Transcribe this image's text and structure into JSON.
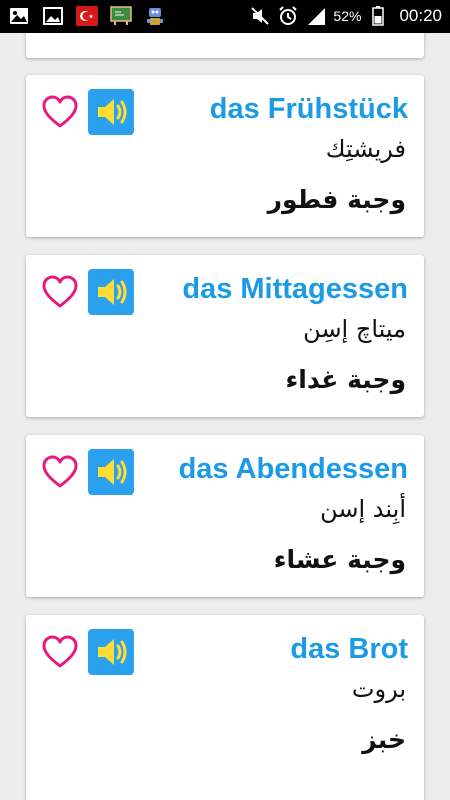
{
  "status_bar": {
    "icons_left": [
      "image-icon",
      "gallery-icon",
      "turkey-flag-icon",
      "classroom-icon",
      "robot-icon"
    ],
    "icons_right": [
      "mute-icon",
      "alarm-icon",
      "signal-icon",
      "battery-icon"
    ],
    "battery": "52%",
    "time": "00:20"
  },
  "colors": {
    "accent": "#1b9ae6",
    "heart": "#e7197f",
    "speaker_bg": "#2aa0ee",
    "speaker_fg": "#ffdd33"
  },
  "cards": [
    {
      "german": "das Frühstück",
      "transliteration": "فريشتِك",
      "arabic": "وجبة فطور"
    },
    {
      "german": "das Mittagessen",
      "transliteration": "ميتاچ إسِن",
      "arabic": "وجبة غداء"
    },
    {
      "german": "das Abendessen",
      "transliteration": "أبِند إسن",
      "arabic": "وجبة عشاء"
    },
    {
      "german": "das Brot",
      "transliteration": "بروت",
      "arabic": "خبز"
    }
  ]
}
